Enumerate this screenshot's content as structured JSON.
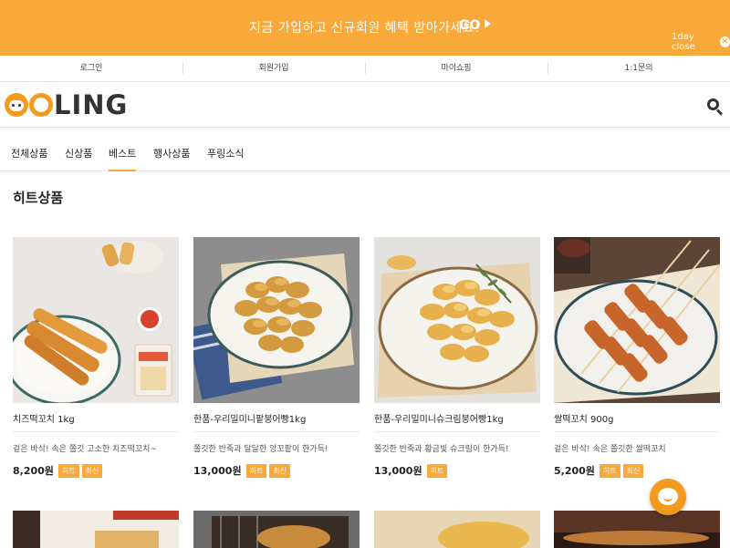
{
  "promo": {
    "text": "지금 가입하고 신규회원 혜택 받아가세요!",
    "go": "GO",
    "close": "1day close"
  },
  "topnav": [
    {
      "label": "로그인"
    },
    {
      "label": "회원가입"
    },
    {
      "label": "마이쇼핑"
    },
    {
      "label": "1:1문의"
    }
  ],
  "logo": {
    "text": "LING"
  },
  "categories": [
    {
      "label": "전체상품"
    },
    {
      "label": "신상품"
    },
    {
      "label": "베스트",
      "active": true
    },
    {
      "label": "행사상품"
    },
    {
      "label": "푸링소식"
    }
  ],
  "section": {
    "title": "히트상품"
  },
  "products": [
    {
      "name": "치즈떡꼬치 1kg",
      "desc": "겉은 바삭! 속은 쫄깃 고소한 치즈떡꼬치~",
      "price": "8,200원",
      "badges": [
        "히트",
        "최신"
      ]
    },
    {
      "name": "한품-우리밀미니팥붕어빵1kg",
      "desc": "쫄깃한 반죽과 달달한 앙꼬팥이 한가득!",
      "price": "13,000원",
      "badges": [
        "히트",
        "최신"
      ]
    },
    {
      "name": "한품-우리밀미니슈크림붕어빵1kg",
      "desc": "쫄깃한 반죽과 황금빛 슈크림이 한가득!",
      "price": "13,000원",
      "badges": [
        "히트"
      ]
    },
    {
      "name": "쌀떡꼬치 900g",
      "desc": "겉은 바삭! 속은 쫄깃한 쌀떡꼬치",
      "price": "5,200원",
      "badges": [
        "히트",
        "최신"
      ]
    }
  ],
  "colors": {
    "accent": "#f9a93a",
    "brand": "#f49a1f"
  }
}
